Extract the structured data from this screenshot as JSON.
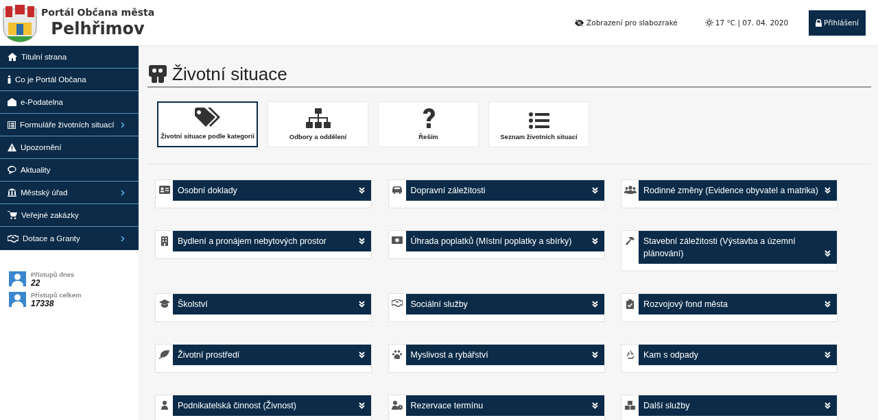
{
  "header": {
    "portal_title": "Portál Občana města",
    "city": "Pelhřimov",
    "accessibility_link": "Zobrazení pro slabozraké",
    "weather": "17 °C | 07. 04. 2020",
    "login_button": "Přihlášení"
  },
  "sidebar": {
    "items": [
      {
        "label": "Titulní strana",
        "has_submenu": false
      },
      {
        "label": "Co je Portál Občana",
        "has_submenu": false
      },
      {
        "label": "e-Podatelna",
        "has_submenu": false
      },
      {
        "label": "Formuláře životních situací",
        "has_submenu": true
      },
      {
        "label": "Upozornění",
        "has_submenu": false
      },
      {
        "label": "Aktuality",
        "has_submenu": false
      },
      {
        "label": "Městský úřad",
        "has_submenu": true
      },
      {
        "label": "Veřejné zakázky",
        "has_submenu": false
      },
      {
        "label": "Dotace a Granty",
        "has_submenu": true
      }
    ],
    "counters": [
      {
        "label": "Přístupů dnes",
        "value": "22"
      },
      {
        "label": "Přístupů celkem",
        "value": "17338"
      }
    ]
  },
  "page_title": "Životní situace",
  "view_tabs": [
    {
      "label": "Životní situace podle kategorií",
      "selected": true
    },
    {
      "label": "Odbory a oddělení",
      "selected": false
    },
    {
      "label": "Řeším",
      "selected": false
    },
    {
      "label": "Seznam životních situací",
      "selected": false
    }
  ],
  "categories": [
    {
      "title": "Osobní doklady",
      "expanded": false
    },
    {
      "title": "Dopravní záležitosti",
      "expanded": false
    },
    {
      "title": "Rodinné změny (Evidence obyvatel a matrika)",
      "expanded": false
    },
    {
      "title": "Bydlení a pronájem nebytových prostor",
      "expanded": false
    },
    {
      "title": "Úhrada poplatků (Místní poplatky a sbírky)",
      "expanded": false
    },
    {
      "title": "Stavební záležitosti (Výstavba a územní plánování)",
      "expanded": false
    },
    {
      "title": "Školství",
      "expanded": false
    },
    {
      "title": "Sociální služby",
      "expanded": false
    },
    {
      "title": "Rozvojový fond města",
      "expanded": false
    },
    {
      "title": "Životní prostředí",
      "expanded": false
    },
    {
      "title": "Myslivost a rybářství",
      "expanded": false
    },
    {
      "title": "Kam s odpady",
      "expanded": false
    },
    {
      "title": "Podnikatelská činnost (Živnost)",
      "expanded": false
    },
    {
      "title": "Rezervace termínu",
      "expanded": false
    },
    {
      "title": "Další služby",
      "expanded": false
    }
  ]
}
